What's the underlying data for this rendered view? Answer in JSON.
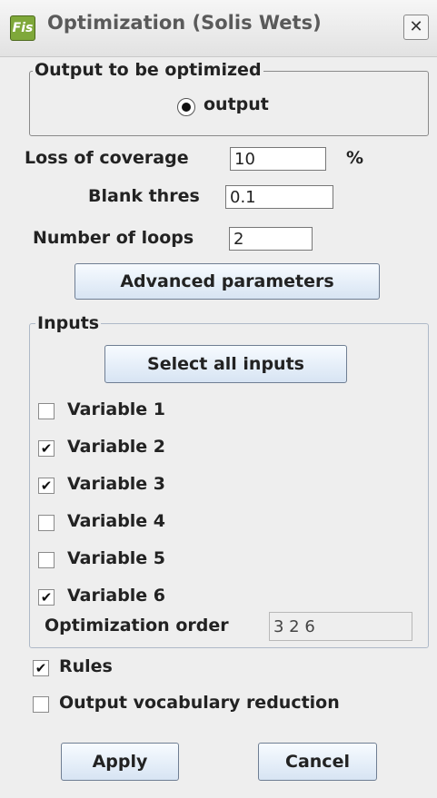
{
  "window": {
    "title": "Optimization (Solis Wets)",
    "app_icon_text": "Fis",
    "close_glyph": "✕"
  },
  "output_group": {
    "legend": "Output to be optimized",
    "radio_label": "output",
    "selected": true
  },
  "params": {
    "loss_label": "Loss of coverage",
    "loss_value": "10",
    "loss_unit": "%",
    "blank_label": "Blank thres",
    "blank_value": "0.1",
    "loops_label": "Number of loops",
    "loops_value": "2",
    "advanced_button": "Advanced parameters"
  },
  "inputs_group": {
    "legend": "Inputs",
    "select_all_button": "Select all inputs",
    "variables": [
      {
        "label": "Variable 1",
        "checked": false
      },
      {
        "label": "Variable 2",
        "checked": true
      },
      {
        "label": "Variable 3",
        "checked": true
      },
      {
        "label": "Variable 4",
        "checked": false
      },
      {
        "label": "Variable 5",
        "checked": false
      },
      {
        "label": "Variable 6",
        "checked": true
      }
    ],
    "order_label": "Optimization order",
    "order_value": "3 2 6"
  },
  "options": {
    "rules_label": "Rules",
    "rules_checked": true,
    "vocab_label": "Output vocabulary reduction",
    "vocab_checked": false
  },
  "footer": {
    "apply_button": "Apply",
    "cancel_button": "Cancel"
  },
  "check_glyph": "✔"
}
